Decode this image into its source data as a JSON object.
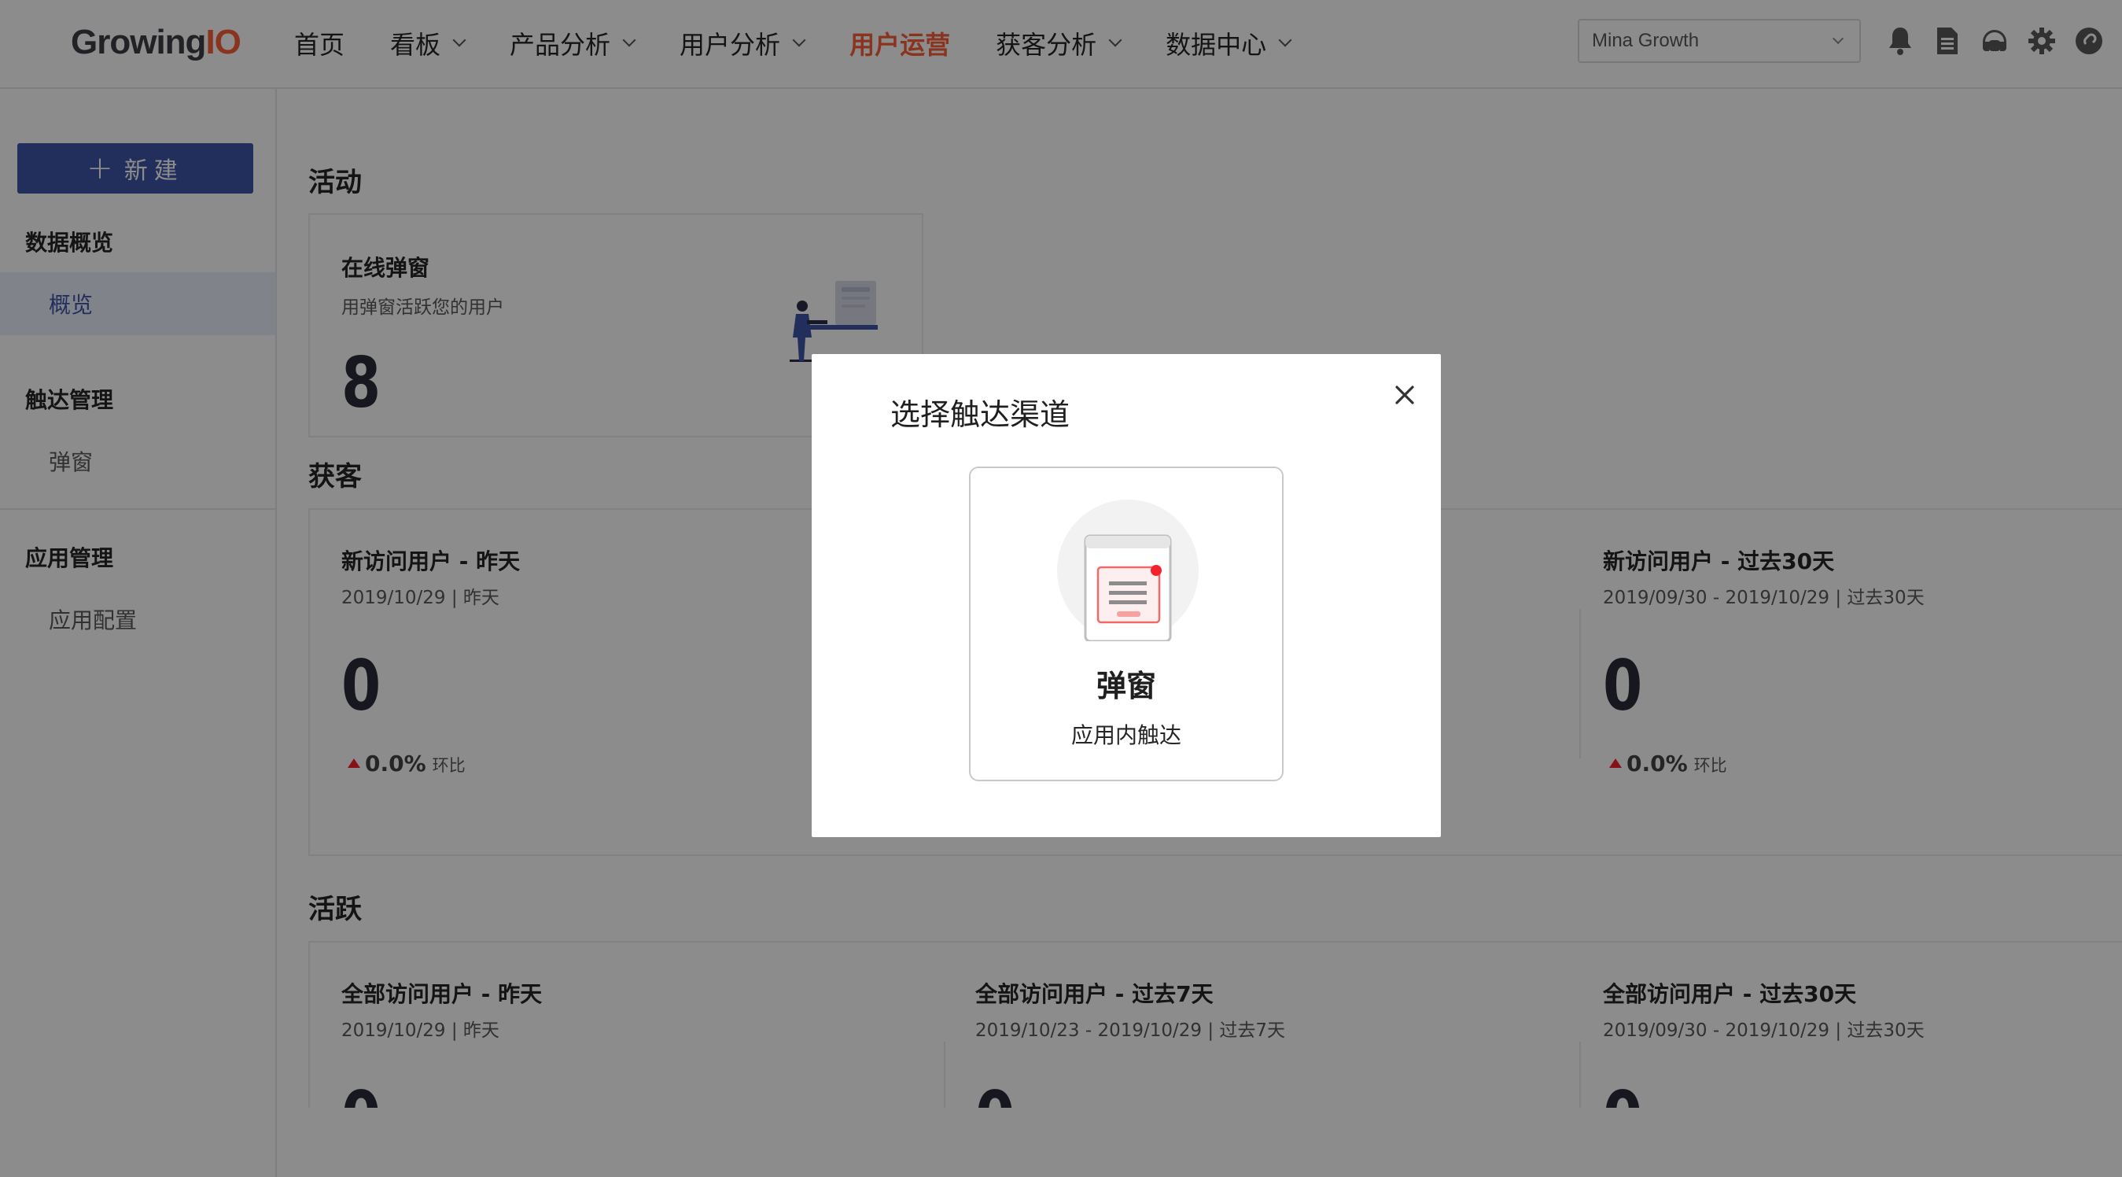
{
  "app": {
    "logo_main": "Growing",
    "logo_accent": "IO"
  },
  "nav": {
    "items": [
      {
        "label": "首页"
      },
      {
        "label": "看板"
      },
      {
        "label": "产品分析"
      },
      {
        "label": "用户分析"
      },
      {
        "label": "用户运营"
      },
      {
        "label": "获客分析"
      },
      {
        "label": "数据中心"
      }
    ],
    "project": "Mina Growth"
  },
  "sidebar": {
    "new_label": "新建",
    "groups": [
      {
        "title": "数据概览",
        "items": [
          {
            "label": "概览"
          }
        ]
      },
      {
        "title": "触达管理",
        "items": [
          {
            "label": "弹窗"
          }
        ]
      },
      {
        "title": "应用管理",
        "items": [
          {
            "label": "应用配置"
          }
        ]
      }
    ]
  },
  "main": {
    "activity": {
      "title": "活动",
      "card": {
        "title": "在线弹窗",
        "subtitle": "用弹窗活跃您的用户",
        "value": "8"
      }
    },
    "acquisition": {
      "title": "获客",
      "cards": [
        {
          "title": "新访问用户 - 昨天",
          "subtitle": "2019/10/29 | 昨天",
          "value": "0",
          "trend": "0.0%",
          "trend_label": "环比"
        },
        {
          "title": "新访问用户 - 过去30天",
          "subtitle": "2019/09/30 - 2019/10/29 | 过去30天",
          "value": "0",
          "trend": "0.0%",
          "trend_label": "环比"
        }
      ]
    },
    "active": {
      "title": "活跃",
      "cards": [
        {
          "title": "全部访问用户 - 昨天",
          "subtitle": "2019/10/29 | 昨天",
          "value": "0"
        },
        {
          "title": "全部访问用户 - 过去7天",
          "subtitle": "2019/10/23 - 2019/10/29 | 过去7天",
          "value": "0"
        },
        {
          "title": "全部访问用户 - 过去30天",
          "subtitle": "2019/09/30 - 2019/10/29 | 过去30天",
          "value": "0"
        }
      ]
    }
  },
  "modal": {
    "title": "选择触达渠道",
    "channel": {
      "name": "弹窗",
      "description": "应用内触达"
    }
  }
}
